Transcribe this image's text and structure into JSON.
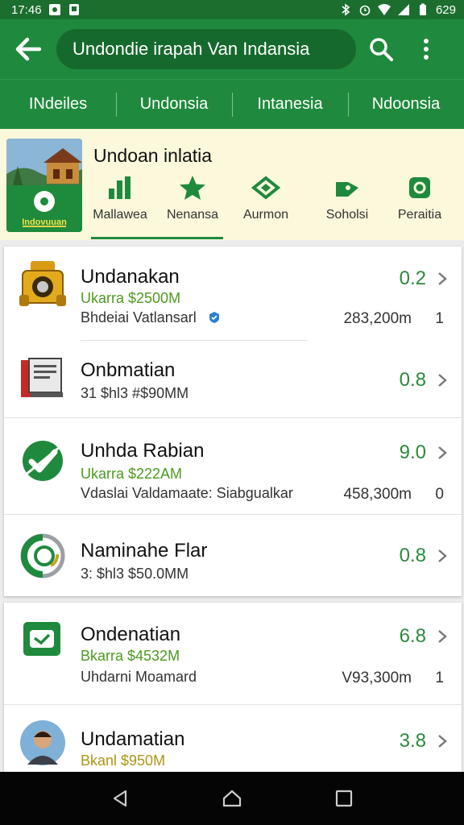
{
  "status_bar": {
    "time": "17:46",
    "battery": "629"
  },
  "app_bar": {
    "search_text": "Undondie irapah Van Indansia"
  },
  "tabs": [
    {
      "label": "INdeiles"
    },
    {
      "label": "Undonsia"
    },
    {
      "label": "Intanesia"
    },
    {
      "label": "Ndoonsia"
    }
  ],
  "promo": {
    "title": "Undoan inlatia",
    "image_caption": "Indovuuan",
    "categories": [
      {
        "label": "Mallawea",
        "icon": "bar-chart-icon"
      },
      {
        "label": "Nenansa",
        "icon": "star-icon"
      },
      {
        "label": "Aurmon",
        "icon": "diamond-icon"
      },
      {
        "label": "Soholsi",
        "icon": "tag-icon"
      },
      {
        "label": "Peraitia",
        "icon": "square-ring-icon"
      }
    ]
  },
  "items": [
    {
      "title": "Undanakan",
      "sub": "Ukarra $2500M",
      "line": "Bhdeiai Vatlansarl",
      "score": "0.2",
      "amount": "283,200m",
      "count": "1",
      "icon": "camera-icon"
    },
    {
      "title": "Onbmatian",
      "line": "31 $hl3 #$90MM",
      "score": "0.8",
      "icon": "monitor-icon"
    },
    {
      "title": "Unhda Rabian",
      "sub": "Ukarra $222AM",
      "line": "Vdaslai Valdamaate: Siabgualkar",
      "score": "9.0",
      "amount": "458,300m",
      "count": "0",
      "icon": "check-badge-icon"
    },
    {
      "title": "Naminahe Flar",
      "line": "3: $hl3 $50.0MM",
      "score": "0.8",
      "icon": "ring-logo-icon"
    },
    {
      "title": "Ondenatian",
      "sub": "Bkarra $4532M",
      "line": "Uhdarni Moamard",
      "score": "6.8",
      "amount": "V93,300m",
      "count": "1",
      "icon": "wallet-icon"
    },
    {
      "title": "Undamatian",
      "sub": "Bkanl $950M",
      "score": "3.8",
      "icon": "avatar-icon"
    }
  ]
}
